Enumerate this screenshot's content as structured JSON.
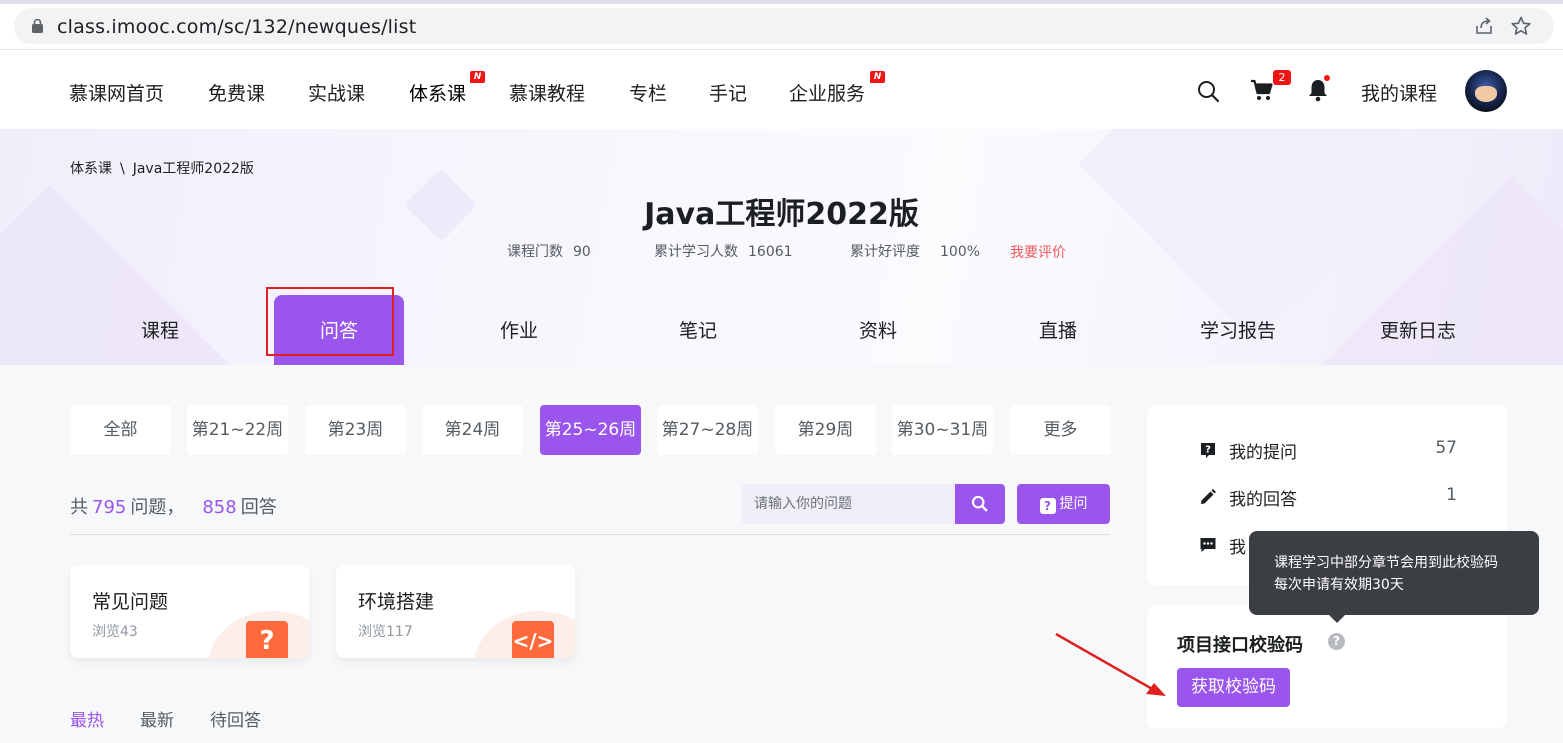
{
  "browser": {
    "url": "class.imooc.com/sc/132/newques/list"
  },
  "nav": {
    "items": [
      {
        "label": "慕课网首页"
      },
      {
        "label": "免费课"
      },
      {
        "label": "实战课"
      },
      {
        "label": "体系课",
        "badge": "N"
      },
      {
        "label": "慕课教程"
      },
      {
        "label": "专栏"
      },
      {
        "label": "手记"
      },
      {
        "label": "企业服务",
        "badge": "N"
      }
    ],
    "cart_count": "2",
    "my_courses": "我的课程"
  },
  "hero": {
    "breadcrumb_parent": "体系课",
    "breadcrumb_sep": "\\",
    "breadcrumb_current": "Java工程师2022版",
    "title": "Java工程师2022版",
    "stats": [
      {
        "label": "课程门数",
        "value": "90"
      },
      {
        "label": "累计学习人数",
        "value": "16061"
      },
      {
        "label": "累计好评度",
        "value": "100%"
      }
    ],
    "rate_link": "我要评价",
    "tabs": [
      "课程",
      "问答",
      "作业",
      "笔记",
      "资料",
      "直播",
      "学习报告",
      "更新日志"
    ],
    "active_tab": "问答"
  },
  "filters": {
    "weeks": [
      "全部",
      "第21~22周",
      "第23周",
      "第24周",
      "第25~26周",
      "第27~28周",
      "第29周",
      "第30~31周",
      "更多"
    ],
    "active_week": "第25~26周"
  },
  "summary": {
    "prefix": "共",
    "questions": "795",
    "questions_label": "问题，",
    "answers": "858",
    "answers_label": "回答"
  },
  "search": {
    "placeholder": "请输入你的问题",
    "ask_label": "提问"
  },
  "topics": [
    {
      "name": "常见问题",
      "views": "浏览43",
      "icon": "question-icon"
    },
    {
      "name": "环境搭建",
      "views": "浏览117",
      "icon": "code-icon"
    }
  ],
  "sort": {
    "tabs": [
      "最热",
      "最新",
      "待回答"
    ],
    "active": "最热"
  },
  "sidebar": {
    "rows": [
      {
        "label": "我的提问",
        "count": "57",
        "icon": "question-box-icon"
      },
      {
        "label": "我的回答",
        "count": "1",
        "icon": "pencil-icon"
      },
      {
        "label": "我",
        "count": "",
        "icon": "comment-icon"
      }
    ],
    "code_title": "项目接口校验码",
    "get_code_label": "获取校验码",
    "tooltip_line1": "课程学习中部分章节会用到此校验码",
    "tooltip_line2": "每次申请有效期30天"
  },
  "colors": {
    "accent": "#9a55ec",
    "badge_red": "#f01414",
    "tooltip_bg": "#3b3f44",
    "annotation_red": "#e02020"
  }
}
